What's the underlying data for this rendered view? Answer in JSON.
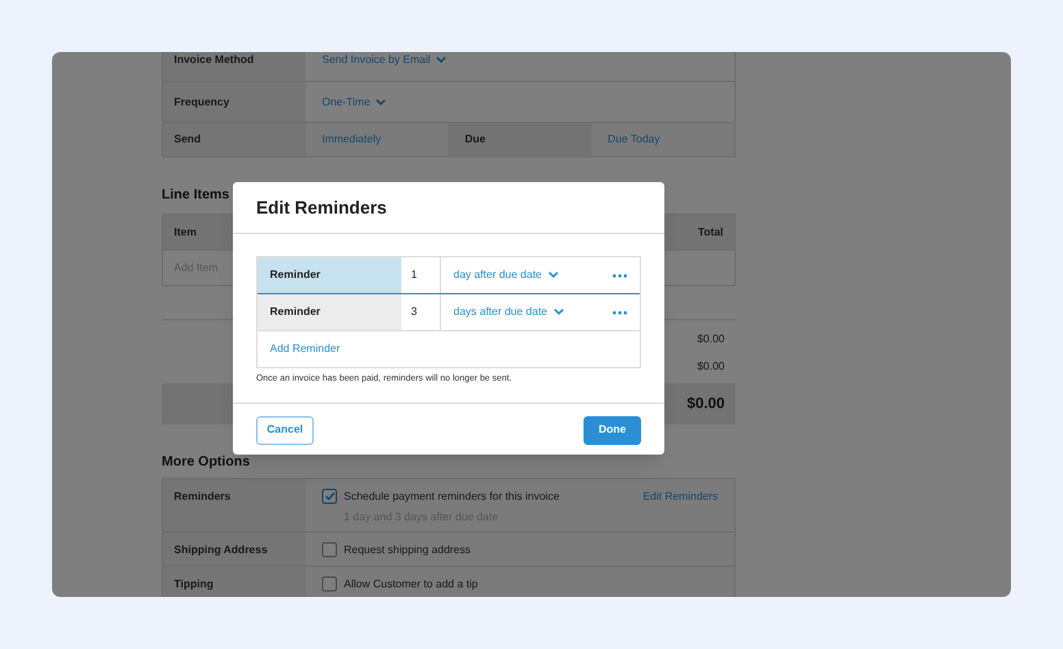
{
  "invoice_settings": [
    {
      "label": "Invoice Method",
      "cells": [
        {
          "kind": "dropdown",
          "text": "Send Invoice by Email"
        }
      ]
    },
    {
      "label": "Frequency",
      "cells": [
        {
          "kind": "dropdown",
          "text": "One-Time"
        }
      ]
    },
    {
      "label": "Send",
      "cells": [
        {
          "kind": "link",
          "text": "Immediately"
        },
        {
          "kind": "label",
          "text": "Due"
        },
        {
          "kind": "link",
          "text": "Due Today"
        }
      ]
    }
  ],
  "line_items": {
    "title": "Line Items",
    "columns": [
      "Item",
      "Total"
    ],
    "add_item_placeholder": "Add Item",
    "subtotals": [
      "$0.00",
      "$0.00"
    ],
    "total": "$0.00"
  },
  "more_options": {
    "title": "More Options",
    "rows": [
      {
        "label": "Reminders",
        "checked": true,
        "text": "Schedule payment reminders for this invoice",
        "detail": "1 day and 3 days after due date",
        "link": "Edit Reminders"
      },
      {
        "label": "Shipping Address",
        "checked": false,
        "text": "Request shipping address"
      },
      {
        "label": "Tipping",
        "checked": false,
        "text": "Allow Customer to add a tip"
      }
    ]
  },
  "dialog": {
    "title": "Edit Reminders",
    "reminders": [
      {
        "label": "Reminder",
        "number": "1",
        "timing": "day after due date",
        "selected": true
      },
      {
        "label": "Reminder",
        "number": "3",
        "timing": "days after due date",
        "selected": false
      }
    ],
    "add_link": "Add Reminder",
    "note": "Once an invoice has been paid, reminders will no longer be sent.",
    "buttons": [
      {
        "kind": "secondary",
        "label": "Cancel"
      },
      {
        "kind": "primary",
        "label": "Done"
      }
    ]
  }
}
